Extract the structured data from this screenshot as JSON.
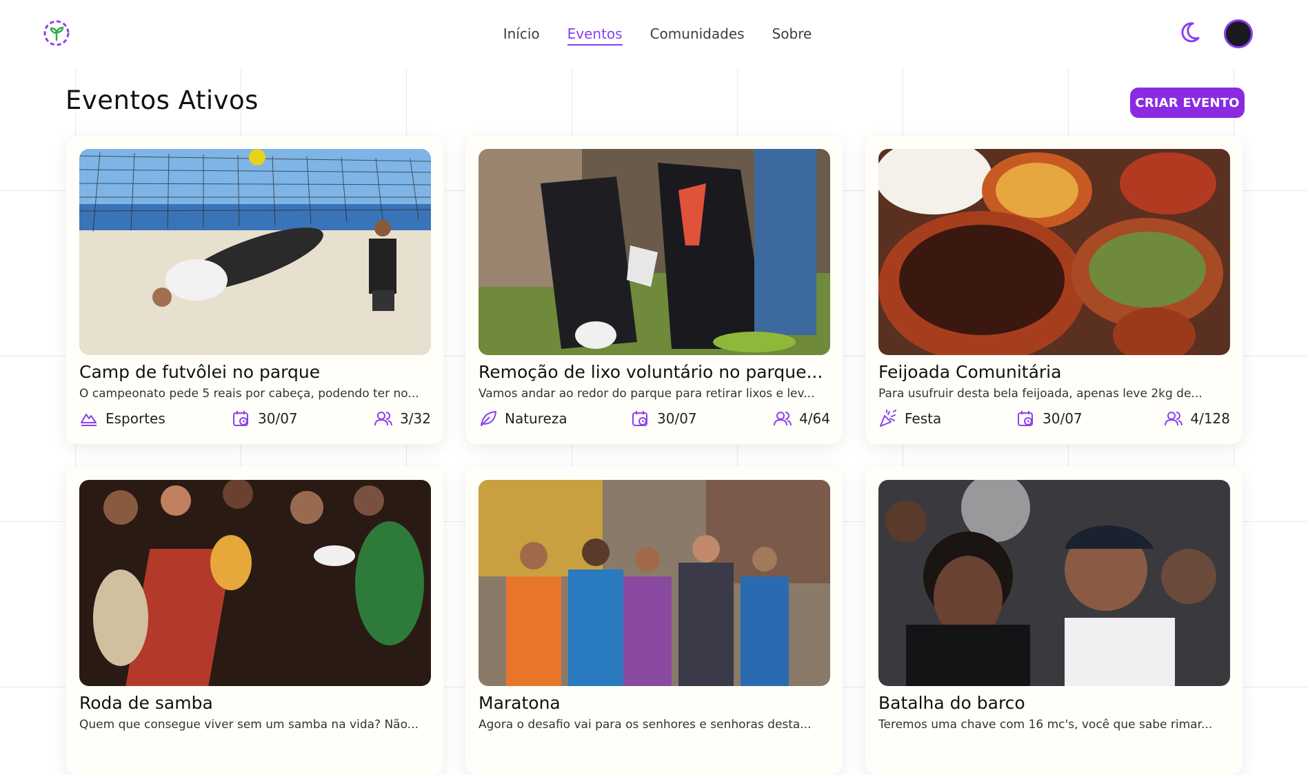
{
  "nav": {
    "items": [
      "Início",
      "Eventos",
      "Comunidades",
      "Sobre"
    ],
    "active": "Eventos"
  },
  "page": {
    "title": "Eventos Ativos",
    "create_label": "CRIAR EVENTO"
  },
  "accent": "#8a2be2",
  "events": [
    {
      "title": "Camp de futvôlei no parque",
      "desc": "O campeonato pede 5 reais por cabeça, podendo ter no...",
      "category": "Esportes",
      "category_icon": "sport-icon",
      "date": "30/07",
      "attendees": "3/32"
    },
    {
      "title": "Remoção de lixo voluntário no parque...",
      "desc": "Vamos andar ao redor do parque para retirar lixos e lev...",
      "category": "Natureza",
      "category_icon": "leaf-icon",
      "date": "30/07",
      "attendees": "4/64"
    },
    {
      "title": "Feijoada Comunitária",
      "desc": "Para usufruir desta bela feijoada, apenas leve 2kg de...",
      "category": "Festa",
      "category_icon": "party-icon",
      "date": "30/07",
      "attendees": "4/128"
    },
    {
      "title": "Roda de samba",
      "desc": "Quem que consegue viver sem um samba na vida? Não..."
    },
    {
      "title": "Maratona",
      "desc": "Agora o desafio vai para os senhores e senhoras desta..."
    },
    {
      "title": "Batalha do barco",
      "desc": "Teremos uma chave com 16 mc's, você que sabe rimar..."
    }
  ]
}
